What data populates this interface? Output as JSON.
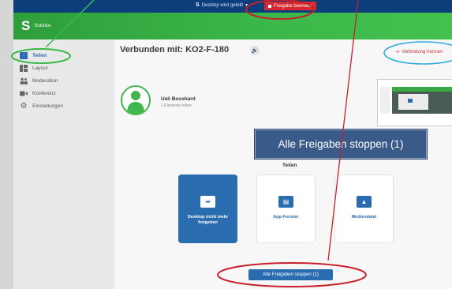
{
  "topbar": {
    "share_indicator": "Desktop wird geteilt",
    "stop_sharing": "Freigabe beenden"
  },
  "app": {
    "brand": "Solstice"
  },
  "sidebar": {
    "items": [
      {
        "label": "Teilen",
        "icon": "share-icon",
        "active": true
      },
      {
        "label": "Layout",
        "icon": "layout-icon"
      },
      {
        "label": "Moderation",
        "icon": "moderation-icon"
      },
      {
        "label": "Konferenz",
        "icon": "camera-icon"
      },
      {
        "label": "Einstellungen",
        "icon": "gear-icon"
      }
    ]
  },
  "main": {
    "connected_label": "Verbunden mit: KO2-F-180",
    "disconnect_label": "Verbindung trennen",
    "user": {
      "name": "Ueli Bosshard",
      "subtitle": "1 Elemente teilen"
    },
    "callout": "Alle Freigaben stoppen (1)",
    "share_heading": "Teilen",
    "tiles": [
      {
        "label": "Desktop nicht mehr freigeben",
        "icon": "desktop-share-icon",
        "active": true
      },
      {
        "label": "App-Fenster",
        "icon": "app-window-icon"
      },
      {
        "label": "Mediendatei",
        "icon": "image-icon"
      }
    ],
    "stop_all_button": "Alle Freigaben stoppen (1)"
  },
  "colors": {
    "navy": "#0d3e7c",
    "green": "#3cb84a",
    "accent_blue": "#2a6cb0",
    "red": "#d7282f",
    "annotation_red": "#c8202a",
    "annotation_green": "#3cb84a",
    "annotation_cyan": "#2aa8e0"
  }
}
